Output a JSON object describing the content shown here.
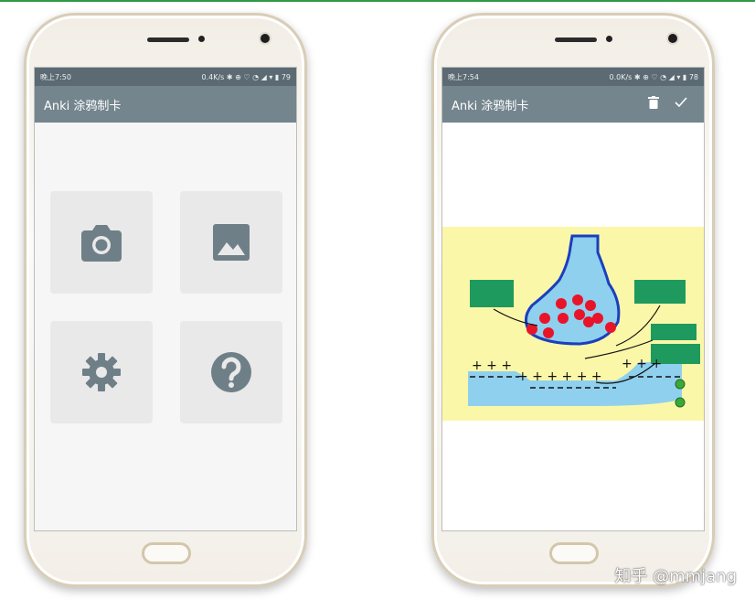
{
  "left_phone": {
    "status": {
      "time": "晚上7:50",
      "indicators": "0.4K/s ✱ ⊕ ♡ ◔ ◢ ▾ ▮ 79"
    },
    "appbar": {
      "title": "Anki 涂鸦制卡"
    },
    "tiles": [
      {
        "icon": "camera-icon"
      },
      {
        "icon": "image-icon"
      },
      {
        "icon": "gear-icon"
      },
      {
        "icon": "help-icon"
      }
    ]
  },
  "right_phone": {
    "status": {
      "time": "晚上7:54",
      "indicators": "0.0K/s ✱ ⊕ ♡ ◔ ◢ ▾ ▮ 78"
    },
    "appbar": {
      "title": "Anki 涂鸦制卡",
      "actions": [
        "delete-icon",
        "check-icon"
      ]
    },
    "drawing": {
      "description_colors": {
        "background": "#fbf7a8",
        "fluid": "#8fd0ee",
        "vesicle": "#e8142a",
        "label_box": "#1e9a5e",
        "outline": "#1a3fbf"
      },
      "top_charges": "+ + +",
      "mid_charges": "+ + + + + +",
      "right_charges": "+ + +"
    }
  },
  "watermark": "知乎 @mmjang",
  "colors": {
    "accent": "#2e9a45",
    "statusbar": "#5c6b73",
    "appbar": "#74858e",
    "tile": "#e9e9e9",
    "icon": "#6f7f87"
  }
}
